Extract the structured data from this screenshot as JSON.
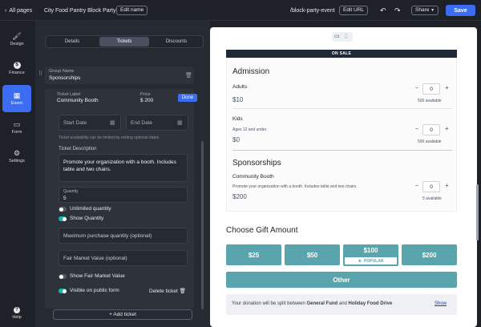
{
  "topbar": {
    "back_label": "All pages",
    "page_title": "City Food Pantry Block Party",
    "edit_name": "Edit name",
    "url": "/block-party-event",
    "edit_url": "Edit URL",
    "share": "Share",
    "save": "Save"
  },
  "rail": {
    "items": [
      {
        "label": "Design",
        "icon": "🖌"
      },
      {
        "label": "Finance",
        "icon": "$"
      },
      {
        "label": "Event",
        "icon": "▦"
      },
      {
        "label": "Form",
        "icon": "▭"
      },
      {
        "label": "Settings",
        "icon": "⚙"
      }
    ],
    "help": "Help"
  },
  "editor": {
    "tabs": [
      "Details",
      "Tickets",
      "Discounts"
    ],
    "group_name_label": "Group Name",
    "group_name_value": "Sponsorships",
    "ticket_label_label": "Ticket Label",
    "ticket_label_value": "Community Booth",
    "price_label": "Price",
    "price_value": "$ 200",
    "done": "Done",
    "start_date_placeholder": "Start Date",
    "end_date_placeholder": "End Date",
    "date_hint": "Ticket availability can be limited by setting optional dates.",
    "description_label": "Ticket Description",
    "description_value": "Promote your organization with a booth. Includes table and two chairs.",
    "quantity_label": "Quantity",
    "quantity_value": "5",
    "unlimited_quantity": "Unlimited quantity",
    "show_quantity": "Show Quantity",
    "max_purchase_placeholder": "Maximum purchase quantity (optional)",
    "fmv_placeholder": "Fair Market Value (optional)",
    "show_fmv": "Show Fair Market Value",
    "visible_public": "Visible on public form",
    "delete_ticket": "Delete ticket",
    "add_ticket": "+ Add ticket"
  },
  "preview": {
    "on_sale": "ON SALE",
    "admission_title": "Admission",
    "adults": {
      "name": "Adults",
      "price": "$10",
      "qty": "0",
      "available": "500 available"
    },
    "kids": {
      "name": "Kids",
      "note": "Ages 12 and under.",
      "price": "$0",
      "qty": "0",
      "available": "500 available"
    },
    "sponsorships_title": "Sponsorships",
    "booth": {
      "name": "Community Booth",
      "note": "Promote your organization with a booth. Includes table and two chairs.",
      "price": "$200",
      "qty": "0",
      "available": "5 available"
    },
    "gift_title": "Choose Gift Amount",
    "amounts": [
      "$25",
      "$50",
      "$100",
      "$200"
    ],
    "popular": "POPULAR",
    "other": "Other",
    "split_prefix": "Your donation will be split between ",
    "split_fund1": "General Fund",
    "split_and": " and ",
    "split_fund2": "Holiday Food Drive",
    "show": "Show"
  },
  "colors": {
    "accent": "#3b6cf2",
    "teal": "#5aa5ad",
    "toggle_on": "#14b8a6"
  }
}
